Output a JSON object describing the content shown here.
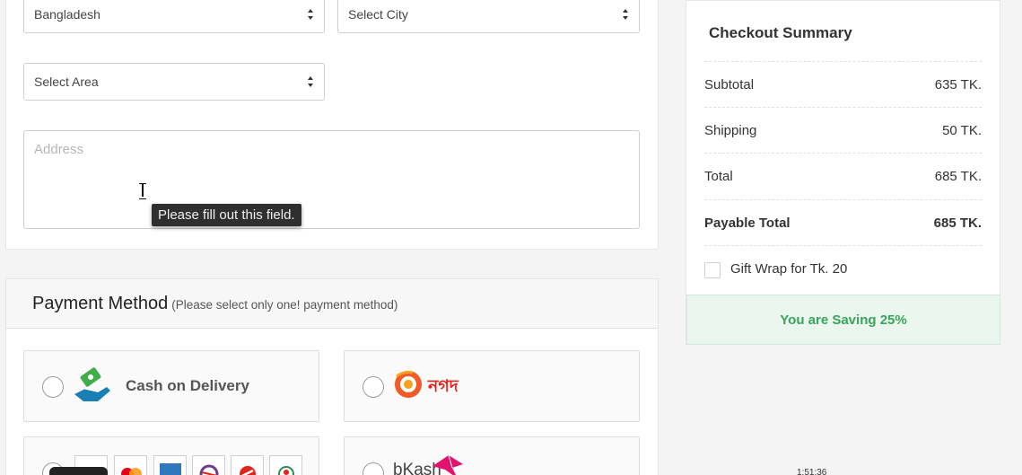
{
  "address_form": {
    "country_select": "Bangladesh",
    "city_select": "Select City",
    "area_select": "Select Area",
    "address_placeholder": "Address",
    "validation_tooltip": "Please fill out this field."
  },
  "payment": {
    "title": "Payment Method",
    "subtitle": "(Please select only one! payment method)",
    "options": [
      {
        "label": "Cash on Delivery",
        "icon": "cash-hand-icon"
      },
      {
        "label": "নগদ",
        "icon": "nagad-logo"
      },
      {
        "label": "",
        "icon": "card-logos"
      },
      {
        "label": "bKash",
        "icon": "bkash-logo"
      }
    ]
  },
  "summary": {
    "title": "Checkout Summary",
    "rows": [
      {
        "label": "Subtotal",
        "value": "635 TK."
      },
      {
        "label": "Shipping",
        "value": "50 TK."
      },
      {
        "label": "Total",
        "value": "685 TK."
      },
      {
        "label": "Payable Total",
        "value": "685 TK."
      }
    ],
    "gift_wrap_label": "Gift Wrap for Tk. 20",
    "saving_text": "You are Saving 25%"
  },
  "overlay": {
    "video_time": "1:51:36"
  },
  "colors": {
    "saving_green": "#3aa35d",
    "nagad_orange": "#f15a24",
    "bkash_pink": "#e2136e"
  }
}
